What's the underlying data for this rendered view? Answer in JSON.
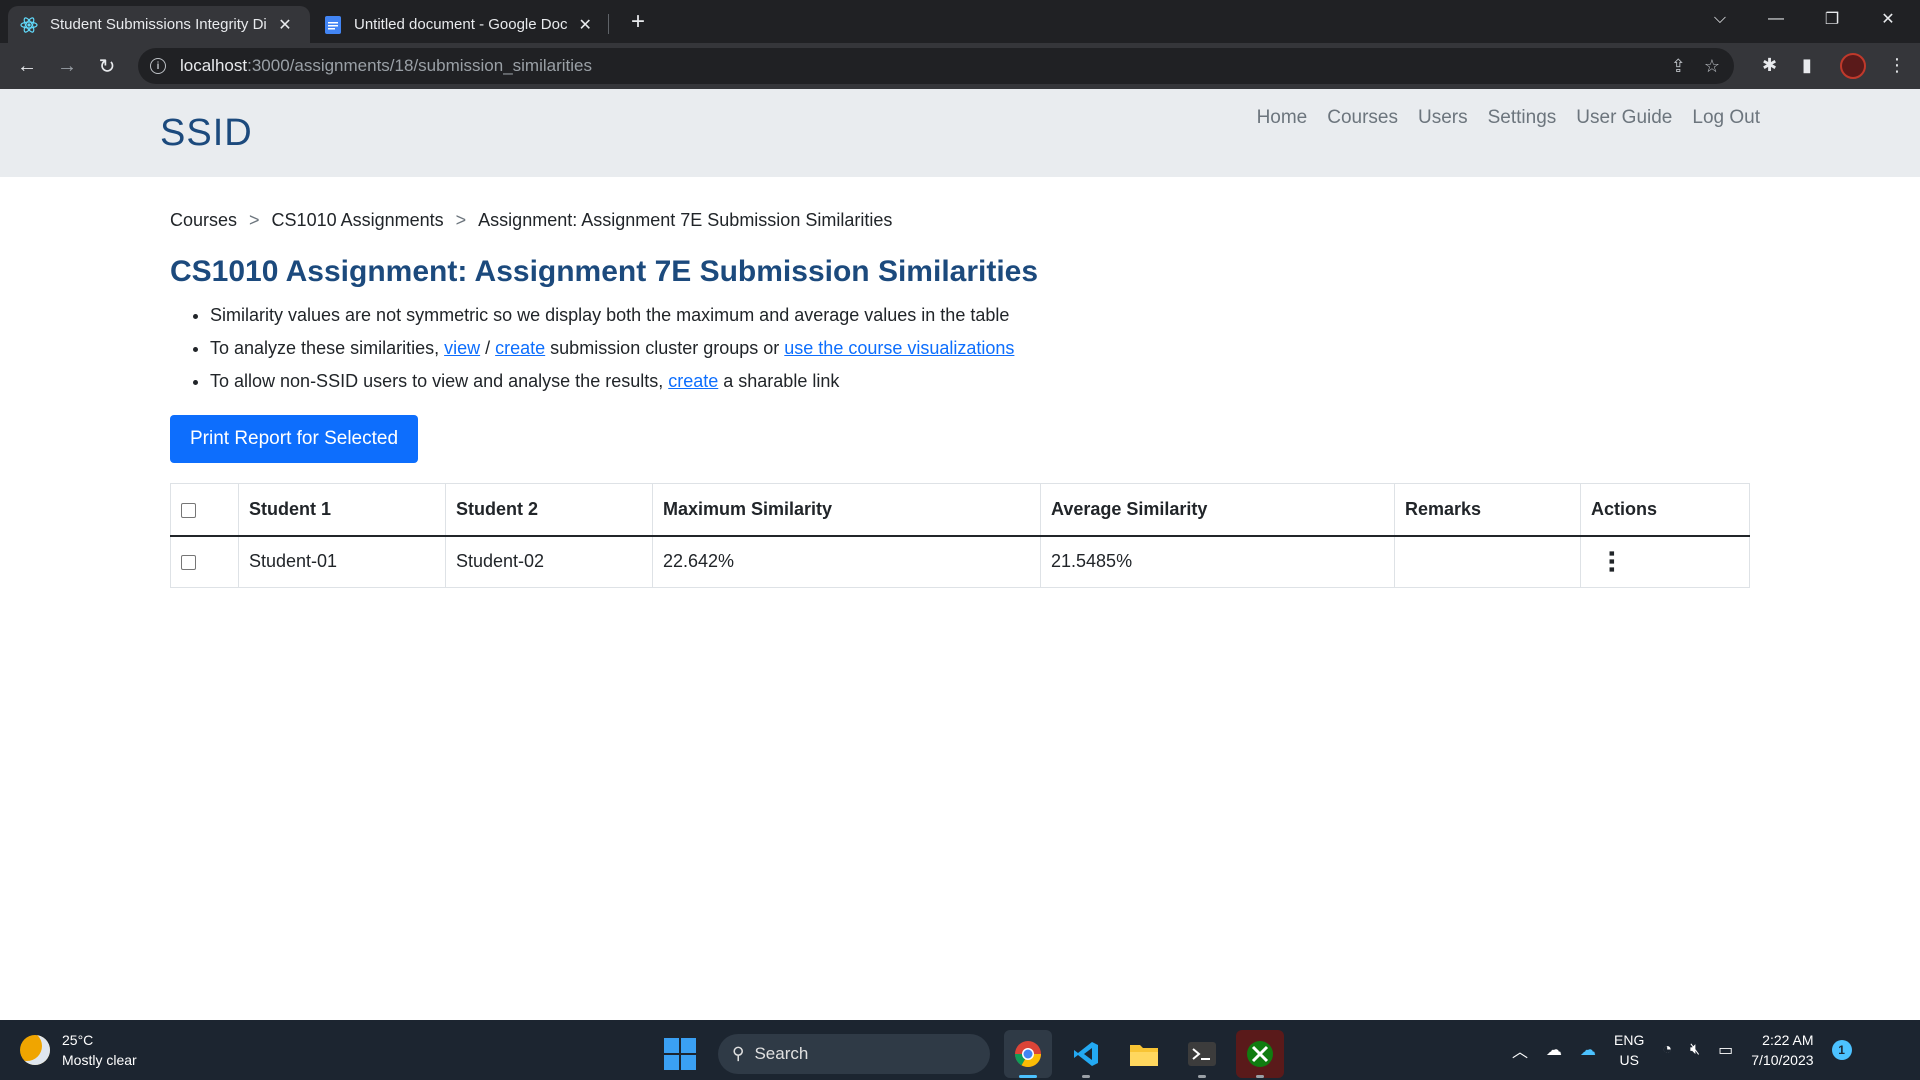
{
  "browser": {
    "tabs": [
      {
        "title": "Student Submissions Integrity Di",
        "active": true,
        "icon": "react-icon"
      },
      {
        "title": "Untitled document - Google Doc",
        "active": false,
        "icon": "google-docs-icon"
      }
    ],
    "url_host": "localhost",
    "url_path": ":3000/assignments/18/submission_similarities"
  },
  "navbar": {
    "brand": "SSID",
    "links": [
      "Home",
      "Courses",
      "Users",
      "Settings",
      "User Guide",
      "Log Out"
    ]
  },
  "breadcrumb": {
    "items": [
      "Courses",
      "CS1010 Assignments",
      "Assignment: Assignment 7E Submission Similarities"
    ],
    "separator": ">"
  },
  "page": {
    "title": "CS1010 Assignment: Assignment 7E Submission Similarities",
    "note1": "Similarity values are not symmetric so we display both the maximum and average values in the table",
    "note2_prefix": "To analyze these similarities, ",
    "note2_link_view": "view",
    "note2_slash": " / ",
    "note2_link_create": "create",
    "note2_middle": " submission cluster groups or ",
    "note2_link_vis": "use the course visualizations",
    "note3_prefix": "To allow non-SSID users to view and analyse the results, ",
    "note3_link_create": "create",
    "note3_suffix": " a sharable link",
    "print_button": "Print Report for Selected"
  },
  "table": {
    "headers": [
      "Student 1",
      "Student 2",
      "Maximum Similarity",
      "Average Similarity",
      "Remarks",
      "Actions"
    ],
    "rows": [
      {
        "student1": "Student-01",
        "student2": "Student-02",
        "max": "22.642%",
        "avg": "21.5485%",
        "remarks": ""
      }
    ]
  },
  "taskbar": {
    "temperature": "25°C",
    "weather": "Mostly clear",
    "search": "Search",
    "lang_top": "ENG",
    "lang_bottom": "US",
    "time": "2:22 AM",
    "date": "7/10/2023",
    "notification_count": "1"
  },
  "colors": {
    "brand": "#1c4a7d",
    "primary": "#0d6efd",
    "navbar_bg": "#e9ecef"
  }
}
